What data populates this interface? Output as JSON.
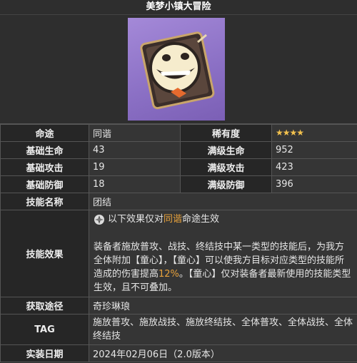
{
  "title": "美梦小镇大冒险",
  "image": {
    "icon": "lightcone-clockie-card-icon"
  },
  "rows": {
    "path": {
      "label": "命途",
      "value": "同谐",
      "rarity_label": "稀有度",
      "rarity_value": "★★★★"
    },
    "base_hp": {
      "label": "基础生命",
      "value": "43",
      "max_label": "满级生命",
      "max_value": "952"
    },
    "base_atk": {
      "label": "基础攻击",
      "value": "19",
      "max_label": "满级攻击",
      "max_value": "423"
    },
    "base_def": {
      "label": "基础防御",
      "value": "18",
      "max_label": "满级防御",
      "max_value": "396"
    },
    "skill_name": {
      "label": "技能名称",
      "value": "团结"
    },
    "skill_effect": {
      "label": "技能效果",
      "intro_prefix": "以下效果仅对",
      "intro_path": "同谐",
      "intro_suffix": "命途生效",
      "text_a": "装备者施放普攻、战技、终结技中某一类型的技能后，为我方全体附加【童心】，【童心】可以使我方目标对应类型的技能所造成的伤害提高",
      "text_pct": "12%",
      "text_b": "。【童心】仅对装备者最新使用的技能类型生效，且不可叠加。"
    },
    "obtain": {
      "label": "获取途径",
      "value": "奇珍琳琅"
    },
    "tag": {
      "label": "TAG",
      "value": "施放普攻、施放战技、施放终结技、全体普攻、全体战技、全体终结技"
    },
    "release": {
      "label": "实装日期",
      "value": "2024年02月06日（2.0版本）"
    }
  }
}
